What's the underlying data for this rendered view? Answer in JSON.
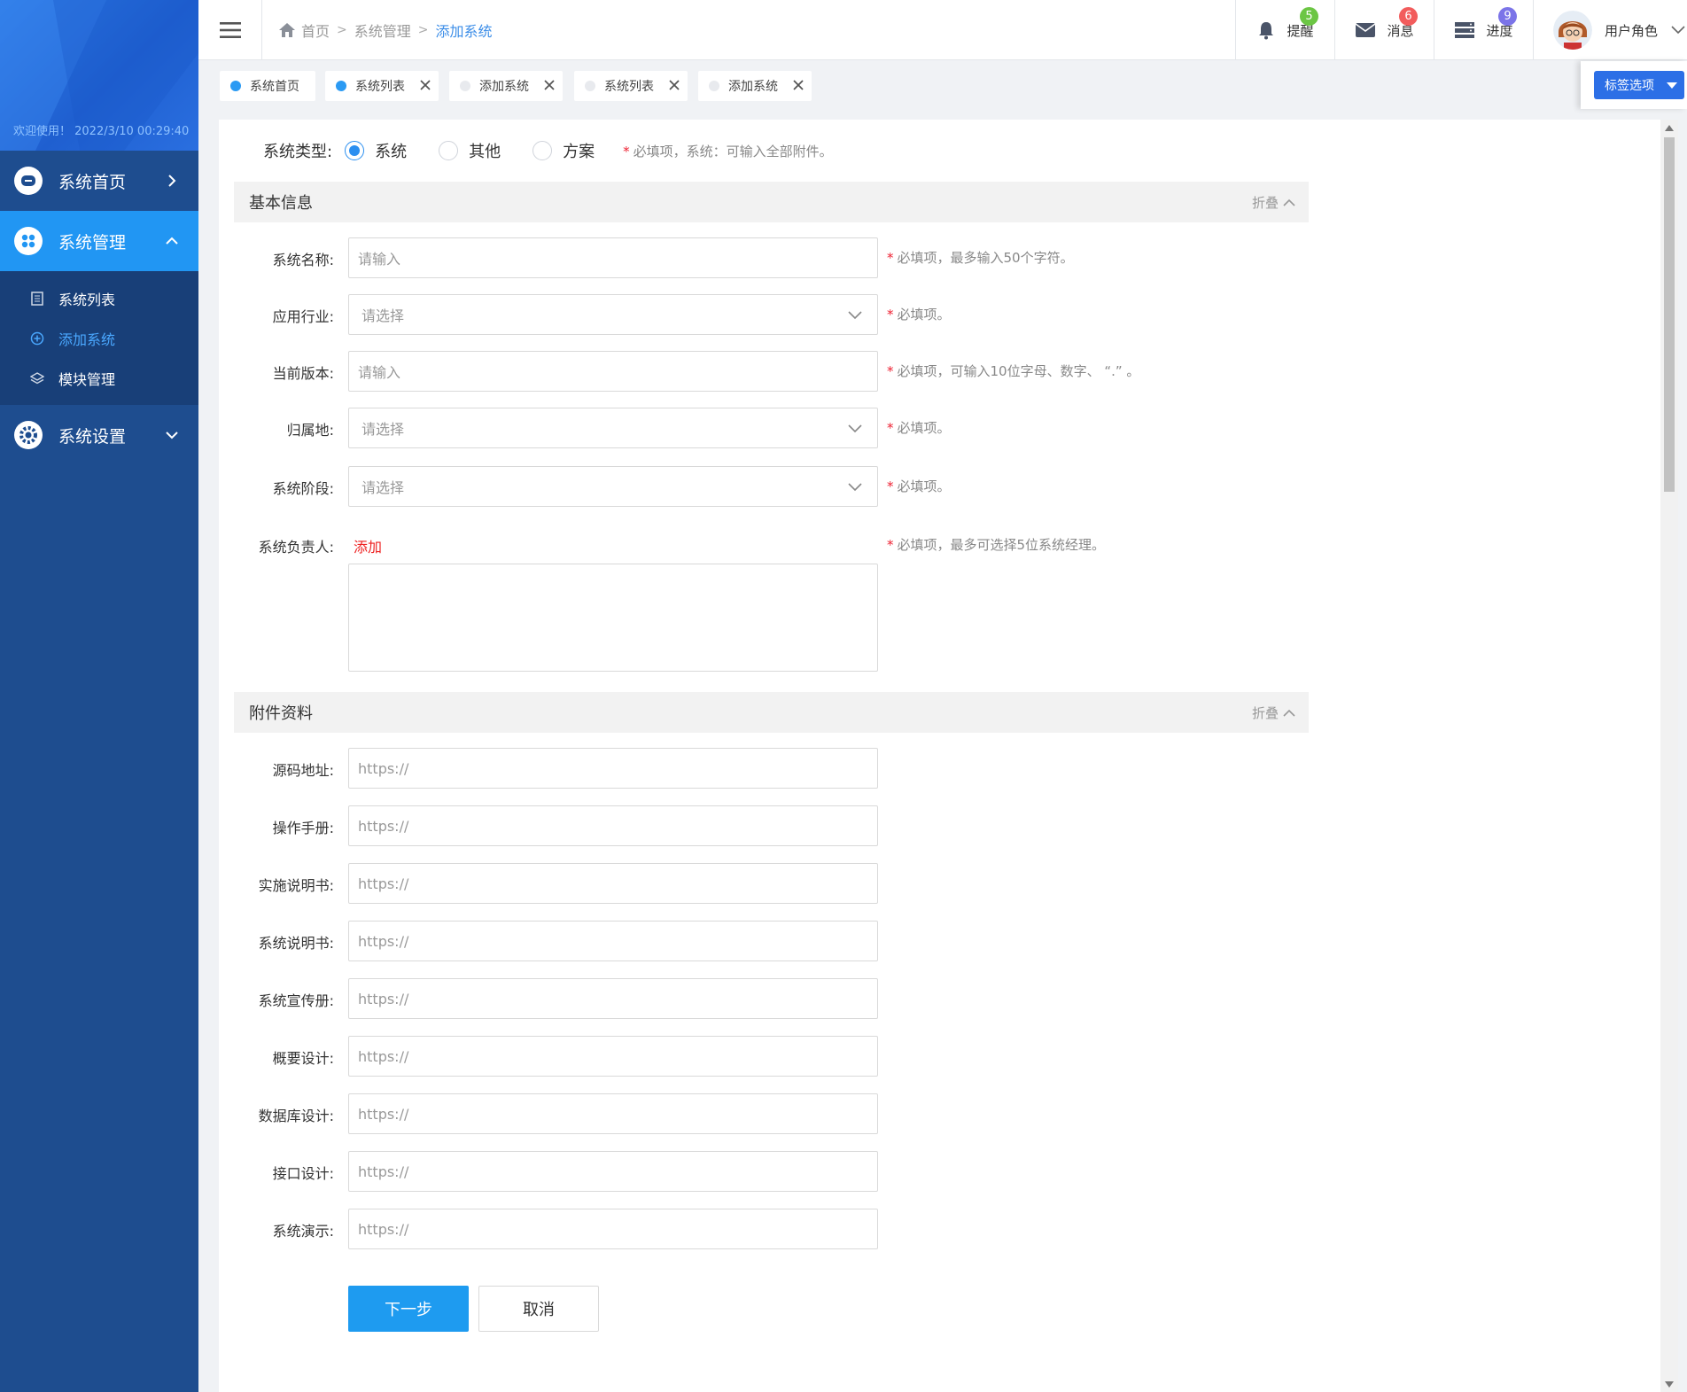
{
  "sidebar": {
    "welcome": "欢迎使用！ 2022/3/10 00:29:40",
    "nav_home": "系统首页",
    "nav_manage": "系统管理",
    "sub_items": [
      "系统列表",
      "添加系统",
      "模块管理"
    ],
    "nav_settings": "系统设置"
  },
  "header": {
    "breadcrumb": [
      "首页",
      "系统管理",
      "添加系统"
    ],
    "remind_label": "提醒",
    "remind_count": "5",
    "message_label": "消息",
    "message_count": "6",
    "progress_label": "进度",
    "progress_count": "9",
    "user_label": "用户角色"
  },
  "tabs": [
    {
      "label": "系统首页",
      "active": true
    },
    {
      "label": "系统列表",
      "active": true
    },
    {
      "label": "添加系统",
      "active": false
    },
    {
      "label": "系统列表",
      "active": false
    },
    {
      "label": "添加系统",
      "active": false
    }
  ],
  "tab_options_label": "标签选项",
  "system_type": {
    "label": "系统类型:",
    "options": [
      "系统",
      "其他",
      "方案"
    ],
    "selected": "系统",
    "hint": "必填项，系统：可输入全部附件。"
  },
  "basic_section": {
    "title": "基本信息",
    "fold_label": "折叠",
    "fields": [
      {
        "label": "系统名称:",
        "placeholder": "请输入",
        "hint": "必填项，最多输入50个字符。"
      },
      {
        "label": "应用行业:",
        "placeholder": "请选择",
        "hint": "必填项。"
      },
      {
        "label": "当前版本:",
        "placeholder": "请输入",
        "hint": "必填项，可输入10位字母、数字、 “.” 。"
      },
      {
        "label": "归属地:",
        "placeholder": "请选择",
        "hint": "必填项。"
      },
      {
        "label": "系统阶段:",
        "placeholder": "请选择",
        "hint": "必填项。"
      }
    ],
    "owner_label": "系统负责人:",
    "owner_add": "添加",
    "owner_hint": "必填项，最多可选择5位系统经理。"
  },
  "attach_section": {
    "title": "附件资料",
    "fold_label": "折叠",
    "fields": [
      {
        "label": "源码地址:",
        "placeholder": "https://"
      },
      {
        "label": "操作手册:",
        "placeholder": "https://"
      },
      {
        "label": "实施说明书:",
        "placeholder": "https://"
      },
      {
        "label": "系统说明书:",
        "placeholder": "https://"
      },
      {
        "label": "系统宣传册:",
        "placeholder": "https://"
      },
      {
        "label": "概要设计:",
        "placeholder": "https://"
      },
      {
        "label": "数据库设计:",
        "placeholder": "https://"
      },
      {
        "label": "接口设计:",
        "placeholder": "https://"
      },
      {
        "label": "系统演示:",
        "placeholder": "https://"
      }
    ]
  },
  "buttons": {
    "next": "下一步",
    "cancel": "取消"
  },
  "colors": {
    "sidebar_bg": "#1e4d8f",
    "active_nav": "#2196f3",
    "primary": "#1e9bf0",
    "required_star": "#ee2233",
    "badge_green": "#6cc644",
    "badge_red": "#f25c5c",
    "badge_purple": "#7b74e8"
  }
}
